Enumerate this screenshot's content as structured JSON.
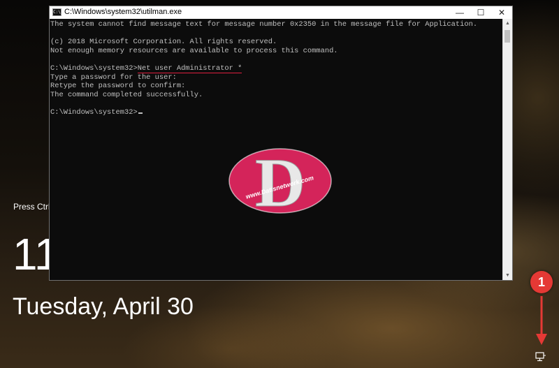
{
  "window": {
    "title": "C:\\Windows\\system32\\utilman.exe",
    "icon_label": "C:\\"
  },
  "console": {
    "lines": [
      "The system cannot find message text for message number 0x2350 in the message file for Application.",
      "",
      "(c) 2018 Microsoft Corporation. All rights reserved.",
      "Not enough memory resources are available to process this command.",
      "",
      "",
      "Type a password for the user:",
      "Retype the password to confirm:",
      "The command completed successfully.",
      "",
      ""
    ],
    "prompt": "C:\\Windows\\system32>",
    "command": "Net user Administrator *"
  },
  "watermark": {
    "text": "www.Datisnetwork.com",
    "letter": "D"
  },
  "lockscreen": {
    "hint": "Press Ctrl+",
    "time": "11",
    "date": "Tuesday, April 30"
  },
  "callout": {
    "number": "1"
  },
  "icons": {
    "title": "console-icon",
    "network": "network-icon"
  },
  "colors": {
    "console_bg": "#0c0c0c",
    "console_text": "#c0c0c0",
    "underline": "#e0203f",
    "callout": "#e53935",
    "watermark": "#d4245a"
  }
}
